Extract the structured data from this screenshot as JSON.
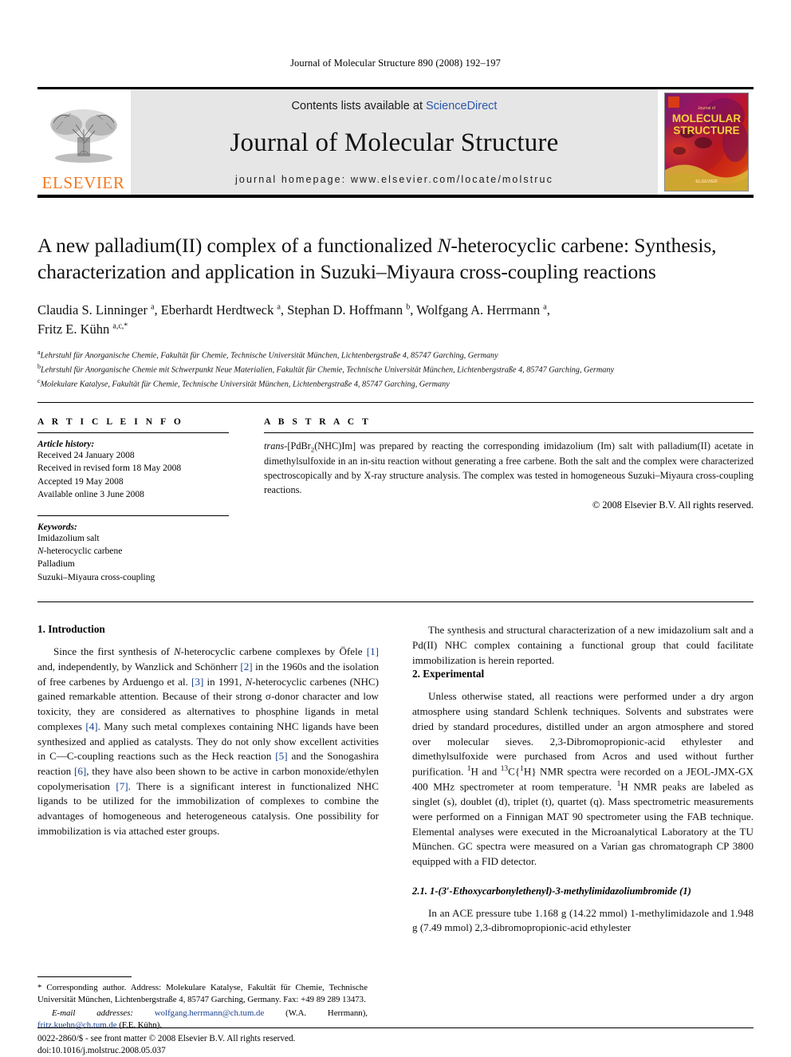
{
  "running_head": "Journal of Molecular Structure 890 (2008) 192–197",
  "masthead": {
    "publisher_name": "ELSEVIER",
    "contents_prefix": "Contents lists available at ",
    "contents_link": "ScienceDirect",
    "journal_title": "Journal of Molecular Structure",
    "homepage": "journal homepage: www.elsevier.com/locate/molstruc",
    "cover_line1": "MOLECULAR",
    "cover_line2": "STRUCTURE",
    "cover_top_label": "Journal of",
    "cover_bottom_label": "ELSEVIER"
  },
  "article": {
    "title_line1_a": "A new palladium(II) complex of a functionalized ",
    "title_line1_i": "N",
    "title_line1_b": "-heterocyclic carbene:",
    "title_line2": "Synthesis, characterization and application in Suzuki–Miyaura cross-coupling",
    "title_line3": "reactions",
    "authors": "Claudia S. Linninger a, Eberhardt Herdtweck a, Stephan D. Hoffmann b, Wolfgang A. Herrmann a, Fritz E. Kühn a,c,*",
    "affiliations": [
      "Lehrstuhl für Anorganische Chemie, Fakultät für Chemie, Technische Universität München, Lichtenbergstraße 4, 85747 Garching, Germany",
      "Lehrstuhl für Anorganische Chemie mit Schwerpunkt Neue Materialien, Fakultät für Chemie, Technische Universität München, Lichtenbergstraße 4, 85747 Garching, Germany",
      "Molekulare Katalyse, Fakultät für Chemie, Technische Universität München, Lichtenbergstraße 4, 85747 Garching, Germany"
    ],
    "affiliation_marks": [
      "a",
      "b",
      "c"
    ]
  },
  "article_info": {
    "heading": "A R T I C L E  I N F O",
    "history_label": "Article history:",
    "history": [
      "Received 24 January 2008",
      "Received in revised form 18 May 2008",
      "Accepted 19 May 2008",
      "Available online 3 June 2008"
    ],
    "keywords_label": "Keywords:",
    "keywords": [
      "Imidazolium salt",
      "N-heterocyclic carbene",
      "Palladium",
      "Suzuki–Miyaura cross-coupling"
    ]
  },
  "abstract": {
    "heading": "A B S T R A C T",
    "text_lead_italic": "trans",
    "text": "-[PdBr2(NHC)Im] was prepared by reacting the corresponding imidazolium (Im) salt with palladium(II) acetate in dimethylsulfoxide in an in-situ reaction without generating a free carbene. Both the salt and the complex were characterized spectroscopically and by X-ray structure analysis. The complex was tested in homogeneous Suzuki–Miyaura cross-coupling reactions.",
    "copyright": "© 2008 Elsevier B.V. All rights reserved."
  },
  "body": {
    "intro_heading": "1. Introduction",
    "intro_p1_parts": [
      "Since the first synthesis of ",
      "N",
      "-heterocyclic carbene complexes by Öfele ",
      "[1]",
      " and, independently, by Wanzlick and Schönherr ",
      "[2]",
      " in the 1960s and the isolation of free carbenes by Arduengo et al. ",
      "[3]",
      " in 1991, ",
      "N",
      "-heterocyclic carbenes (NHC) gained remarkable attention. Because of their strong σ-donor character and low toxicity, they are considered as alternatives to phosphine ligands in metal complexes ",
      "[4]",
      ". Many such metal complexes containing NHC ligands have been synthesized and applied as catalysts. They do not only show excellent activities in C—C-coupling reactions such as the Heck reaction ",
      "[5]",
      " and the Sonogashira reaction ",
      "[6]",
      ", they have also been shown to be active in carbon monoxide/ethylen copolymerisation ",
      "[7]",
      ". There is a significant interest in functionalized NHC ligands to be utilized for the immobilization of complexes to combine the advantages of homogeneous and heterogeneous catalysis. One possibility for immobilization is via attached ester groups."
    ],
    "intro_p2": "The synthesis and structural characterization of a new imidazolium salt and a Pd(II) NHC complex containing a functional group that could facilitate immobilization is herein reported.",
    "exp_heading": "2. Experimental",
    "exp_p1": "Unless otherwise stated, all reactions were performed under a dry argon atmosphere using standard Schlenk techniques. Solvents and substrates were dried by standard procedures, distilled under an argon atmosphere and stored over molecular sieves. 2,3-Dibromopropionic-acid ethylester and dimethylsulfoxide were purchased from Acros and used without further purification. 1H and 13C{1H} NMR spectra were recorded on a JEOL-JMX-GX 400 MHz spectrometer at room temperature. 1H NMR peaks are labeled as singlet (s), doublet (d), triplet (t), quartet (q). Mass spectrometric measurements were performed on a Finnigan MAT 90 spectrometer using the FAB technique. Elemental analyses were executed in the Microanalytical Laboratory at the TU München. GC spectra were measured on a Varian gas chromatograph CP 3800 equipped with a FID detector.",
    "sub_heading_21": "2.1. 1-(3′-Ethoxycarbonylethenyl)-3-methylimidazoliumbromide (1)",
    "sub_21_p1": "In an ACE pressure tube 1.168 g (14.22 mmol) 1-methylimidazole and 1.948 g (7.49 mmol) 2,3-dibromopropionic-acid ethylester"
  },
  "footnote": {
    "star": "*",
    "corresponding": " Corresponding author. Address: Molekulare Katalyse, Fakultät für Chemie, Technische Universität München, Lichtenbergstraße 4, 85747 Garching, Germany. Fax: +49 89 289 13473.",
    "email_label": "E-mail addresses:",
    "email1": "wolfgang.herrmann@ch.tum.de",
    "email1_owner": " (W.A. Herrmann), ",
    "email2": "fritz.kuehn@ch.tum.de",
    "email2_owner": " (F.E. Kühn)."
  },
  "issn": {
    "line1": "0022-2860/$ - see front matter © 2008 Elsevier B.V. All rights reserved.",
    "line2": "doi:10.1016/j.molstruc.2008.05.037"
  },
  "colors": {
    "elsevier_orange": "#F47920",
    "link_blue": "#2b57a8",
    "ref_blue": "#19418c",
    "masthead_gray": "#e6e6e6"
  }
}
